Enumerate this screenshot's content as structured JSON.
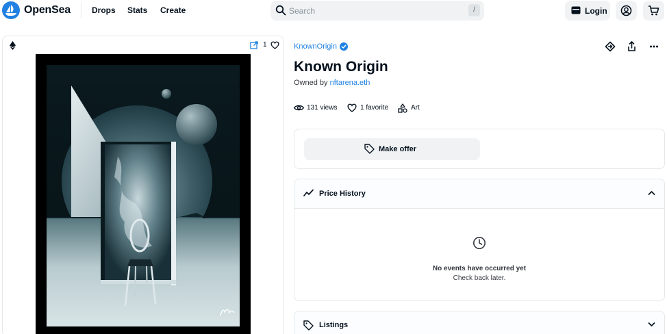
{
  "header": {
    "brand": "OpenSea",
    "nav": [
      "Drops",
      "Stats",
      "Create"
    ],
    "search_placeholder": "Search",
    "search_shortcut": "/",
    "login_label": "Login"
  },
  "media": {
    "favorite_count": "1"
  },
  "item": {
    "collection": "KnownOrigin",
    "title": "Known Origin",
    "owned_by_prefix": "Owned by",
    "owner": "nftarena.eth",
    "views": "131 views",
    "favorites": "1 favorite",
    "category": "Art"
  },
  "offer": {
    "button_label": "Make offer"
  },
  "price_history": {
    "title": "Price History",
    "empty_title": "No events have occurred yet",
    "empty_subtitle": "Check back later."
  },
  "listings": {
    "title": "Listings"
  },
  "colors": {
    "accent": "#2081e2",
    "text": "#04111d",
    "border": "#e5e8eb",
    "button_bg": "#f0f2f4"
  }
}
